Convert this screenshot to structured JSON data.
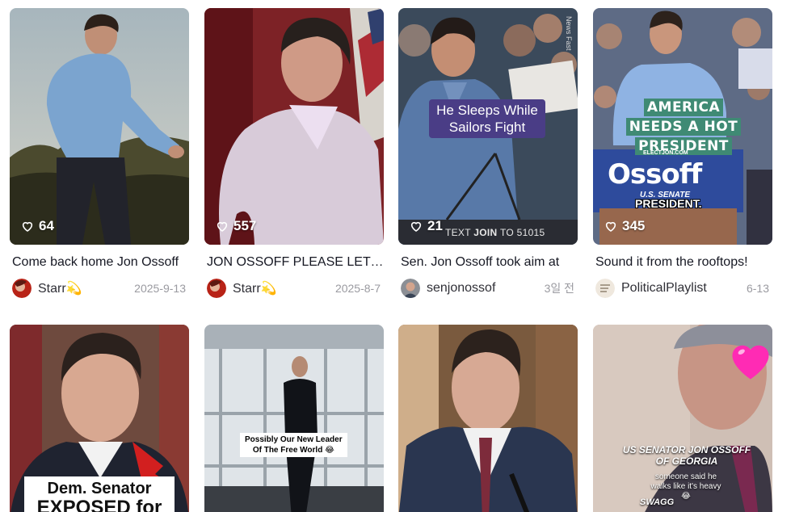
{
  "videos": [
    {
      "title": "Come back home Jon Ossoff",
      "author": "Starr💫",
      "date": "2025-9-13",
      "likes": "64"
    },
    {
      "title": "JON OSSOFF PLEASE LET ME PLAY",
      "author": "Starr💫",
      "date": "2025-8-7",
      "likes": "557"
    },
    {
      "title": "Sen. Jon Ossoff took aim at",
      "author": "senjonossof",
      "date": "3일 전",
      "likes": "21",
      "overlay": "He Sleeps While Sailors Fight",
      "watermark": "News Fast",
      "cta_prefix": "TEXT",
      "cta_join": "JOIN",
      "cta_suffix": "TO 51015"
    },
    {
      "title": "Sound it from the rooftops!",
      "author": "PoliticalPlaylist",
      "date": "6-13",
      "likes": "345",
      "overlay_lines": [
        "AMERICA",
        "NEEDS A HOT",
        "PRESIDENT"
      ],
      "site": "ELECTJON.COM",
      "sign_name": "Ossoff",
      "sign_sub": "U.S. SENATE",
      "sign_pres": "PRESIDENT."
    },
    {
      "exposed_lines": [
        "Dem. Senator",
        "EXPOSED for"
      ]
    },
    {
      "caption_lines": [
        "Possibly Our New Leader",
        "Of The Free World 😂"
      ]
    },
    {},
    {
      "caption_title": [
        "US SENATOR JON OSSOFF",
        "OF GEORGIA"
      ],
      "caption_sub": [
        "someone said he",
        "walks like it's heavy",
        "😂"
      ],
      "caption_tag": "SWAGG"
    }
  ]
}
